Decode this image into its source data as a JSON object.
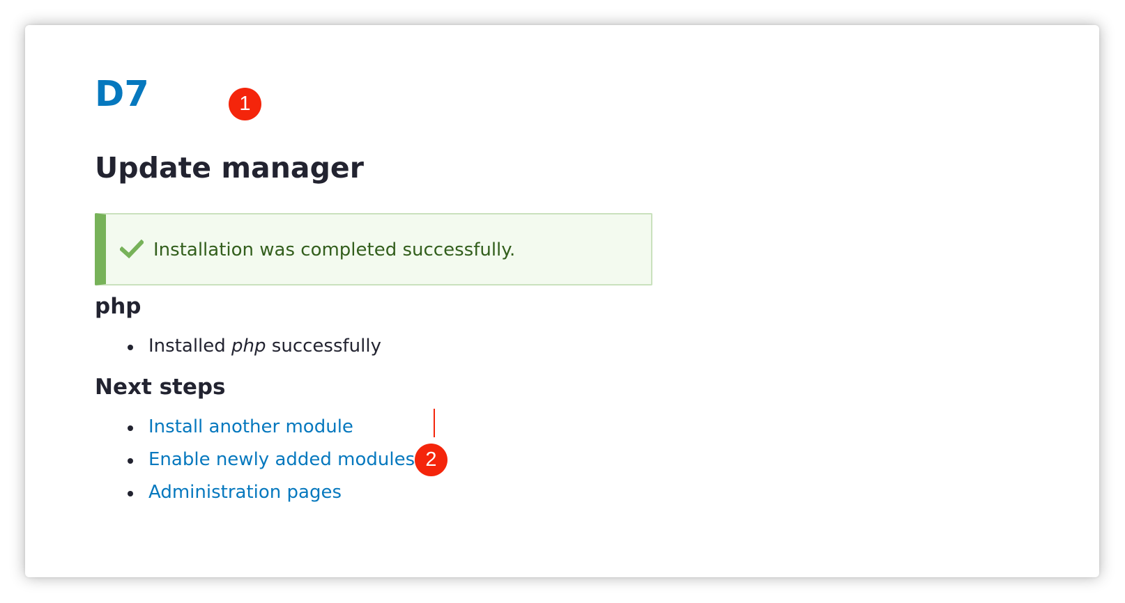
{
  "site": {
    "name": "D7"
  },
  "page": {
    "title": "Update manager"
  },
  "status_message": {
    "icon": "checkmark-icon",
    "text": "Installation was completed successfully.",
    "colors": {
      "background": "#f3faef",
      "border": "#c9e1bd",
      "accent": "#77b259",
      "text": "#325e1c"
    }
  },
  "project_section": {
    "heading": "php",
    "results": [
      {
        "prefix": "Installed ",
        "project": "php",
        "suffix": " successfully"
      }
    ]
  },
  "next_steps": {
    "heading": "Next steps",
    "links": [
      "Install another module",
      "Enable newly added modules",
      "Administration pages"
    ]
  },
  "annotations": {
    "badges": [
      "1",
      "2"
    ],
    "color": "#f4250b"
  },
  "colors": {
    "link": "#0678be",
    "text": "#222330"
  }
}
